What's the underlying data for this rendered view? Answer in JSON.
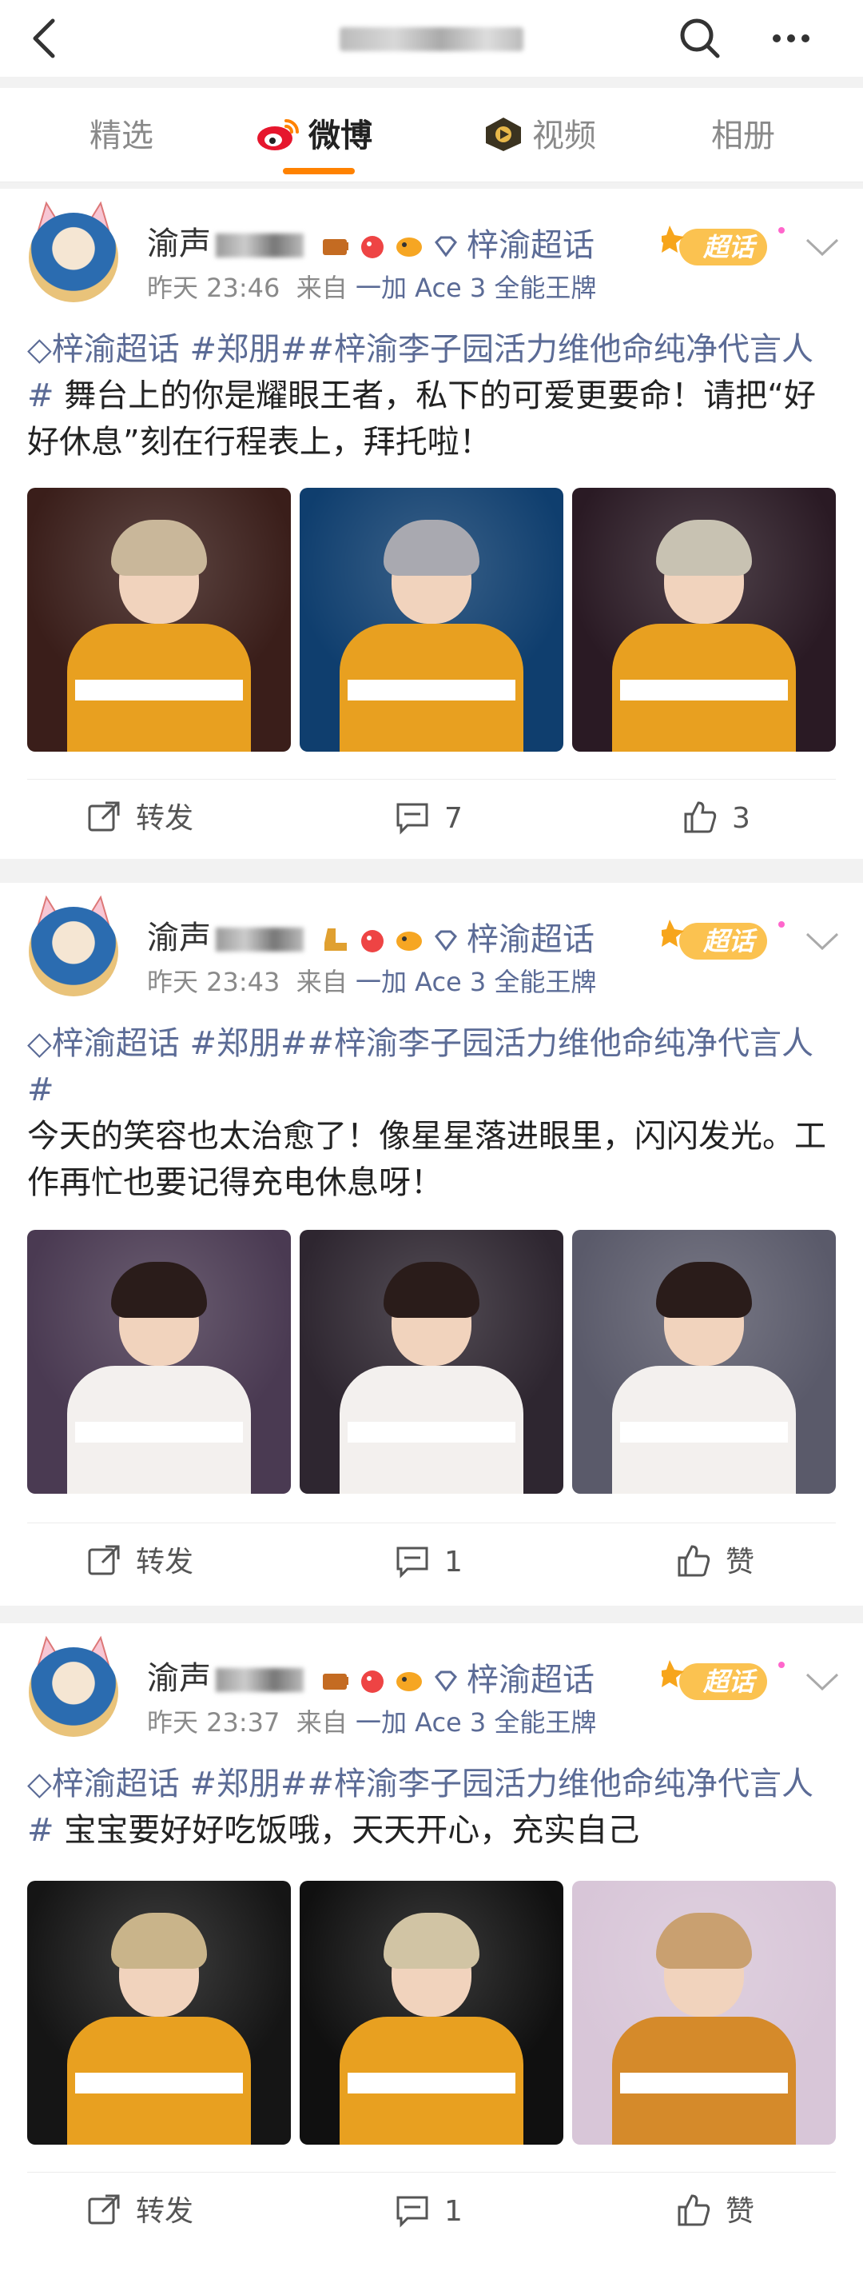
{
  "topbar": {
    "back_icon": "chevron-left-icon",
    "title": "",
    "search_icon": "search-icon",
    "more_icon": "more-horizontal-icon"
  },
  "tabs": [
    {
      "label": "精选",
      "active": false
    },
    {
      "label": "微博",
      "active": true,
      "icon": "weibo-logo-icon"
    },
    {
      "label": "视频",
      "active": false,
      "icon": "video-icon"
    },
    {
      "label": "相册",
      "active": false
    }
  ],
  "accent_color": "#ff8200",
  "link_color": "#5b6b96",
  "posts": [
    {
      "username_prefix": "渝声",
      "topic_badge": "梓渝超话",
      "chaohua_label": "超话",
      "time": "昨天 23:46",
      "source_prefix": "来自",
      "source": "一加 Ace 3 全能王牌",
      "topic_tag": "梓渝超话",
      "hashtags": "#郑朋##梓渝李子园活力维他命纯净代言人#",
      "body": "舞台上的你是耀眼王者，私下的可爱更要命！请把“好好休息”刻在行程表上，拜托啦！",
      "photos": [
        {
          "bg": "#3a1e1a",
          "hair": "#c9b79a",
          "jacket": "#e8a020"
        },
        {
          "bg": "#0f3e6e",
          "hair": "#a9a9b0",
          "jacket": "#e8a020"
        },
        {
          "bg": "#2a1a24",
          "hair": "#c8c2b2",
          "jacket": "#e8a020"
        }
      ],
      "repost_label": "转发",
      "comment_count": "7",
      "like_label": "3"
    },
    {
      "username_prefix": "渝声",
      "topic_badge": "梓渝超话",
      "chaohua_label": "超话",
      "time": "昨天 23:43",
      "source_prefix": "来自",
      "source": "一加 Ace 3 全能王牌",
      "topic_tag": "梓渝超话",
      "hashtags": "#郑朋##梓渝李子园活力维他命纯净代言人#",
      "body": "今天的笑容也太治愈了！像星星落进眼里，闪闪发光。工作再忙也要记得充电休息呀！",
      "photos": [
        {
          "bg": "#4a3a52",
          "hair": "#2a1c1a",
          "jacket": "#f3f0ee"
        },
        {
          "bg": "#2e2630",
          "hair": "#2a1c1a",
          "jacket": "#f3f0ee"
        },
        {
          "bg": "#5a5a6a",
          "hair": "#2a1c1a",
          "jacket": "#f3f0ee"
        }
      ],
      "repost_label": "转发",
      "comment_count": "1",
      "like_label": "赞"
    },
    {
      "username_prefix": "渝声",
      "topic_badge": "梓渝超话",
      "chaohua_label": "超话",
      "time": "昨天 23:37",
      "source_prefix": "来自",
      "source": "一加 Ace 3 全能王牌",
      "topic_tag": "梓渝超话",
      "hashtags": "#郑朋##梓渝李子园活力维他命纯净代言人#",
      "body": "宝宝要好好吃饭哦，天天开心，充实自己",
      "photos": [
        {
          "bg": "#151515",
          "hair": "#c9b48a",
          "jacket": "#e8a020"
        },
        {
          "bg": "#101010",
          "hair": "#d1c4a4",
          "jacket": "#e8a020"
        },
        {
          "bg": "#d8c6d8",
          "hair": "#c9a070",
          "jacket": "#d58a2a"
        }
      ],
      "repost_label": "转发",
      "comment_count": "1",
      "like_label": "赞"
    }
  ]
}
